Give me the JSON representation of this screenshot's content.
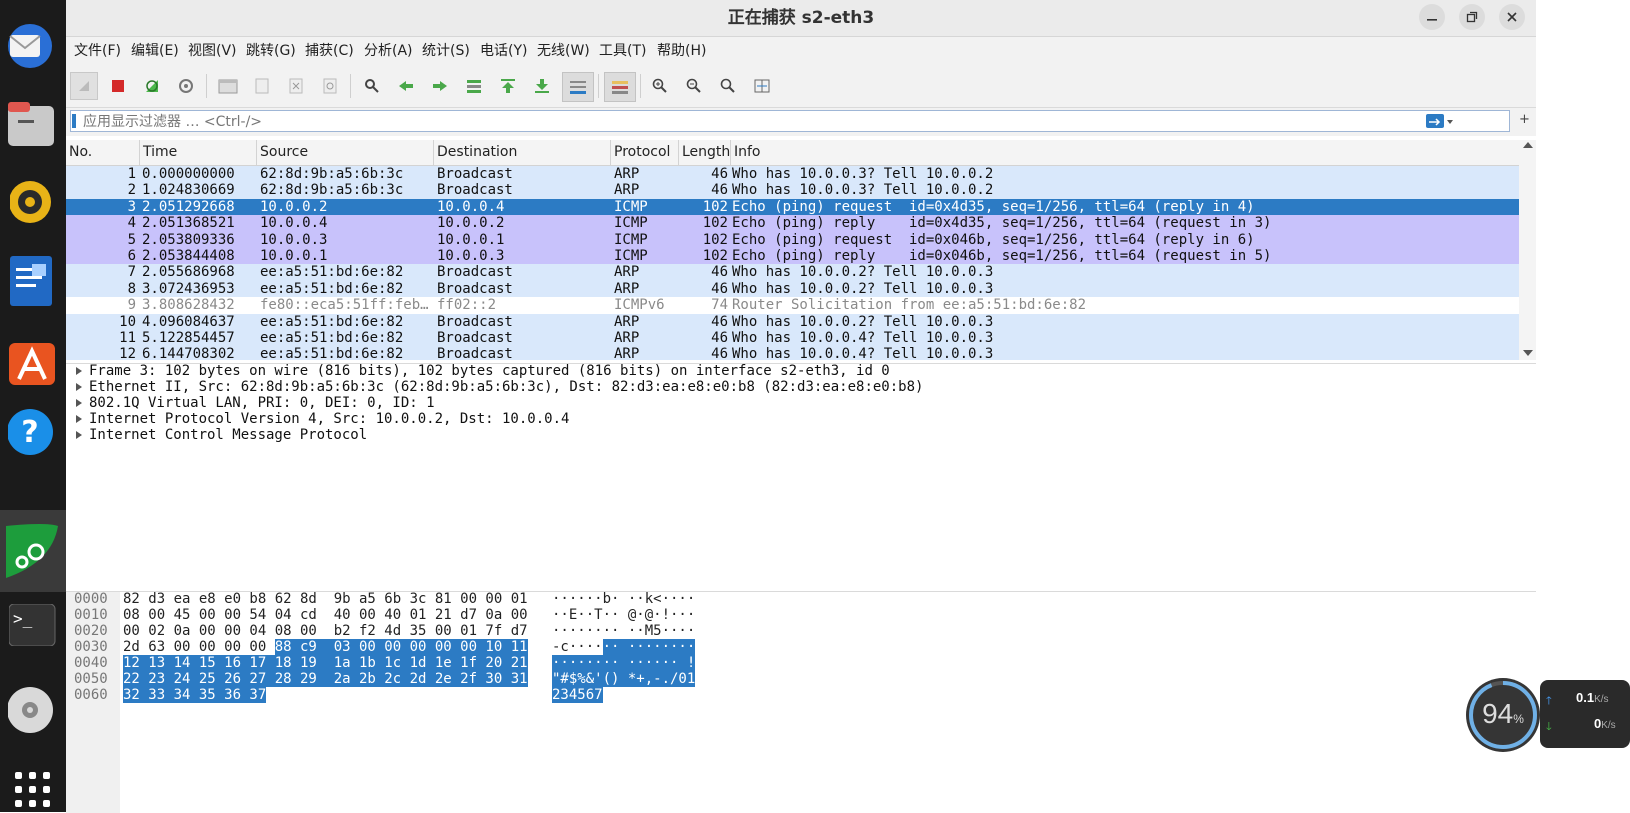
{
  "window": {
    "title": "正在捕获 s2-eth3"
  },
  "menu": [
    "文件(F)",
    "编辑(E)",
    "视图(V)",
    "跳转(G)",
    "捕获(C)",
    "分析(A)",
    "统计(S)",
    "电话(Y)",
    "无线(W)",
    "工具(T)",
    "帮助(H)"
  ],
  "filter": {
    "placeholder": "应用显示过滤器 … <Ctrl-/>"
  },
  "columns": [
    "No.",
    "Time",
    "Source",
    "Destination",
    "Protocol",
    "Length",
    "Info"
  ],
  "packets": [
    {
      "no": "1",
      "time": "0.000000000",
      "src": "62:8d:9b:a5:6b:3c",
      "dst": "Broadcast",
      "proto": "ARP",
      "len": "46",
      "info": "Who has 10.0.0.3? Tell 10.0.0.2",
      "kind": "arp"
    },
    {
      "no": "2",
      "time": "1.024830669",
      "src": "62:8d:9b:a5:6b:3c",
      "dst": "Broadcast",
      "proto": "ARP",
      "len": "46",
      "info": "Who has 10.0.0.3? Tell 10.0.0.2",
      "kind": "arp"
    },
    {
      "no": "3",
      "time": "2.051292668",
      "src": "10.0.0.2",
      "dst": "10.0.0.4",
      "proto": "ICMP",
      "len": "102",
      "info": "Echo (ping) request  id=0x4d35, seq=1/256, ttl=64 (reply in 4)",
      "kind": "selected"
    },
    {
      "no": "4",
      "time": "2.051368521",
      "src": "10.0.0.4",
      "dst": "10.0.0.2",
      "proto": "ICMP",
      "len": "102",
      "info": "Echo (ping) reply    id=0x4d35, seq=1/256, ttl=64 (request in 3)",
      "kind": "icmp"
    },
    {
      "no": "5",
      "time": "2.053809336",
      "src": "10.0.0.3",
      "dst": "10.0.0.1",
      "proto": "ICMP",
      "len": "102",
      "info": "Echo (ping) request  id=0x046b, seq=1/256, ttl=64 (reply in 6)",
      "kind": "icmp"
    },
    {
      "no": "6",
      "time": "2.053844408",
      "src": "10.0.0.1",
      "dst": "10.0.0.3",
      "proto": "ICMP",
      "len": "102",
      "info": "Echo (ping) reply    id=0x046b, seq=1/256, ttl=64 (request in 5)",
      "kind": "icmp"
    },
    {
      "no": "7",
      "time": "2.055686968",
      "src": "ee:a5:51:bd:6e:82",
      "dst": "Broadcast",
      "proto": "ARP",
      "len": "46",
      "info": "Who has 10.0.0.2? Tell 10.0.0.3",
      "kind": "arp"
    },
    {
      "no": "8",
      "time": "3.072436953",
      "src": "ee:a5:51:bd:6e:82",
      "dst": "Broadcast",
      "proto": "ARP",
      "len": "46",
      "info": "Who has 10.0.0.2? Tell 10.0.0.3",
      "kind": "arp"
    },
    {
      "no": "9",
      "time": "3.808628432",
      "src": "fe80::eca5:51ff:feb…",
      "dst": "ff02::2",
      "proto": "ICMPv6",
      "len": "74",
      "info": "Router Solicitation from ee:a5:51:bd:6e:82",
      "kind": "v6"
    },
    {
      "no": "10",
      "time": "4.096084637",
      "src": "ee:a5:51:bd:6e:82",
      "dst": "Broadcast",
      "proto": "ARP",
      "len": "46",
      "info": "Who has 10.0.0.2? Tell 10.0.0.3",
      "kind": "arp"
    },
    {
      "no": "11",
      "time": "5.122854457",
      "src": "ee:a5:51:bd:6e:82",
      "dst": "Broadcast",
      "proto": "ARP",
      "len": "46",
      "info": "Who has 10.0.0.4? Tell 10.0.0.3",
      "kind": "arp"
    },
    {
      "no": "12",
      "time": "6.144708302",
      "src": "ee:a5:51:bd:6e:82",
      "dst": "Broadcast",
      "proto": "ARP",
      "len": "46",
      "info": "Who has 10.0.0.4? Tell 10.0.0.3",
      "kind": "arp"
    }
  ],
  "details": [
    "Frame 3: 102 bytes on wire (816 bits), 102 bytes captured (816 bits) on interface s2-eth3, id 0",
    "Ethernet II, Src: 62:8d:9b:a5:6b:3c (62:8d:9b:a5:6b:3c), Dst: 82:d3:ea:e8:e0:b8 (82:d3:ea:e8:e0:b8)",
    "802.1Q Virtual LAN, PRI: 0, DEI: 0, ID: 1",
    "Internet Protocol Version 4, Src: 10.0.0.2, Dst: 10.0.0.4",
    "Internet Control Message Protocol"
  ],
  "bytes": [
    {
      "off": "0000",
      "hex": "82 d3 ea e8 e0 b8 62 8d  9b a5 6b 3c 81 00 00 01",
      "hl_hex": "",
      "ascii": "······b· ··k<····",
      "hl_ascii": ""
    },
    {
      "off": "0010",
      "hex": "08 00 45 00 00 54 04 cd  40 00 40 01 21 d7 0a 00",
      "hl_hex": "",
      "ascii": "··E··T·· @·@·!···",
      "hl_ascii": ""
    },
    {
      "off": "0020",
      "hex": "00 02 0a 00 00 04 08 00  b2 f2 4d 35 00 01 7f d7",
      "hl_hex": "",
      "ascii": "········ ··M5····",
      "hl_ascii": ""
    },
    {
      "off": "0030",
      "hex": "2d 63 00 00 00 00 ",
      "hl_hex": "88 c9  03 00 00 00 00 00 10 11",
      "ascii": "-c····",
      "hl_ascii": "·· ········"
    },
    {
      "off": "0040",
      "hex": "",
      "hl_hex": "12 13 14 15 16 17 18 19  1a 1b 1c 1d 1e 1f 20 21",
      "ascii": "",
      "hl_ascii": "········ ······ !"
    },
    {
      "off": "0050",
      "hex": "",
      "hl_hex": "22 23 24 25 26 27 28 29  2a 2b 2c 2d 2e 2f 30 31",
      "ascii": "",
      "hl_ascii": "\"#$%&'() *+,-./01"
    },
    {
      "off": "0060",
      "hex": "",
      "hl_hex": "32 33 34 35 36 37",
      "ascii": "",
      "hl_ascii": "234567"
    }
  ],
  "overlay": {
    "cpu_percent": "94",
    "cpu_unit": "%",
    "up": "0.1",
    "down": "0",
    "rate_unit": "K/s"
  },
  "colors": {
    "arp_row": "#d9e8fb",
    "icmp_row": "#c8c2fb",
    "selected_row": "#2c7bc4",
    "v6_row": "#ffffff"
  }
}
